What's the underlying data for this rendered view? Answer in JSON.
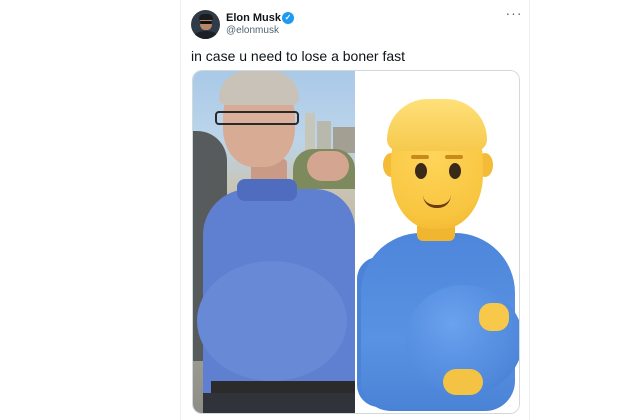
{
  "tweet": {
    "author": {
      "name": "Elon Musk",
      "handle": "@elonmusk",
      "verified_icon": "verified-badge-icon",
      "badge_color": "#1d9bf0"
    },
    "more_icon": "more-options-icon",
    "more_label": "···",
    "text": "in case u need to lose a boner fast",
    "media": {
      "left_image": "photo-man-blue-polo",
      "right_image": "pregnant-man-emoji"
    }
  },
  "colors": {
    "text_primary": "#0f1419",
    "text_secondary": "#536471",
    "border": "#cfd9de"
  }
}
